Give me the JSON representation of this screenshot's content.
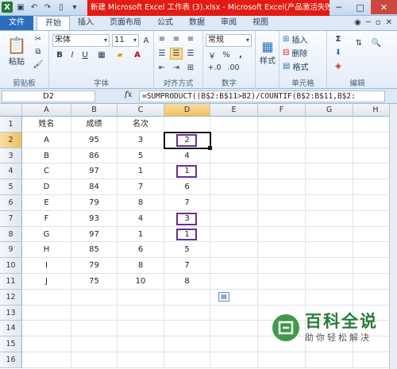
{
  "window": {
    "title": "新建 Microsoft Excel 工作表 (3).xlsx - Microsoft Excel(产品激活失败)",
    "controls": [
      "─",
      "□",
      "✕"
    ]
  },
  "ribbon_tabs": [
    "文件",
    "开始",
    "插入",
    "页面布局",
    "公式",
    "数据",
    "审阅",
    "视图"
  ],
  "clipboard": {
    "paste_label": "粘贴",
    "group": "剪贴板"
  },
  "font": {
    "name": "宋体",
    "size": "11",
    "group": "字体",
    "bold": "B",
    "italic": "I",
    "underline": "U"
  },
  "alignment": {
    "group": "对齐方式"
  },
  "number": {
    "format": "常规",
    "group": "数字",
    "percent": "%",
    "comma": ",",
    "currency": "￥"
  },
  "styles": {
    "label": "样式"
  },
  "cells_group": {
    "insert": "插入",
    "delete": "删除",
    "format": "格式",
    "group": "单元格"
  },
  "editing": {
    "group": "编辑",
    "sum": "Σ"
  },
  "formula_bar": {
    "name_box": "D2",
    "fx": "fx",
    "formula": "=SUMPRODUCT((B$2:B$11>B2)/COUNTIF(B$2:B$11,B$2:"
  },
  "columns": [
    "A",
    "B",
    "C",
    "D",
    "E",
    "F",
    "G",
    "H"
  ],
  "rows": [
    "1",
    "2",
    "3",
    "4",
    "5",
    "6",
    "7",
    "8",
    "9",
    "10",
    "11",
    "12",
    "13",
    "14",
    "15",
    "16"
  ],
  "table": {
    "headers": [
      "姓名",
      "成绩",
      "名次"
    ],
    "rows": [
      [
        "A",
        "95",
        "3",
        "2"
      ],
      [
        "B",
        "86",
        "5",
        "4"
      ],
      [
        "C",
        "97",
        "1",
        "1"
      ],
      [
        "D",
        "84",
        "7",
        "6"
      ],
      [
        "E",
        "79",
        "8",
        "7"
      ],
      [
        "F",
        "93",
        "4",
        "3"
      ],
      [
        "G",
        "97",
        "1",
        "1"
      ],
      [
        "H",
        "85",
        "6",
        "5"
      ],
      [
        "I",
        "79",
        "8",
        "7"
      ],
      [
        "J",
        "75",
        "10",
        "8"
      ]
    ]
  },
  "watermark": {
    "title": "百科全说",
    "subtitle": "助你轻松解决"
  },
  "colors": {
    "title_red": "#e31b12",
    "file_tab": "#2a6ebf",
    "highlight": "#6a2d8f",
    "watermark_green": "#2c7a3a"
  }
}
